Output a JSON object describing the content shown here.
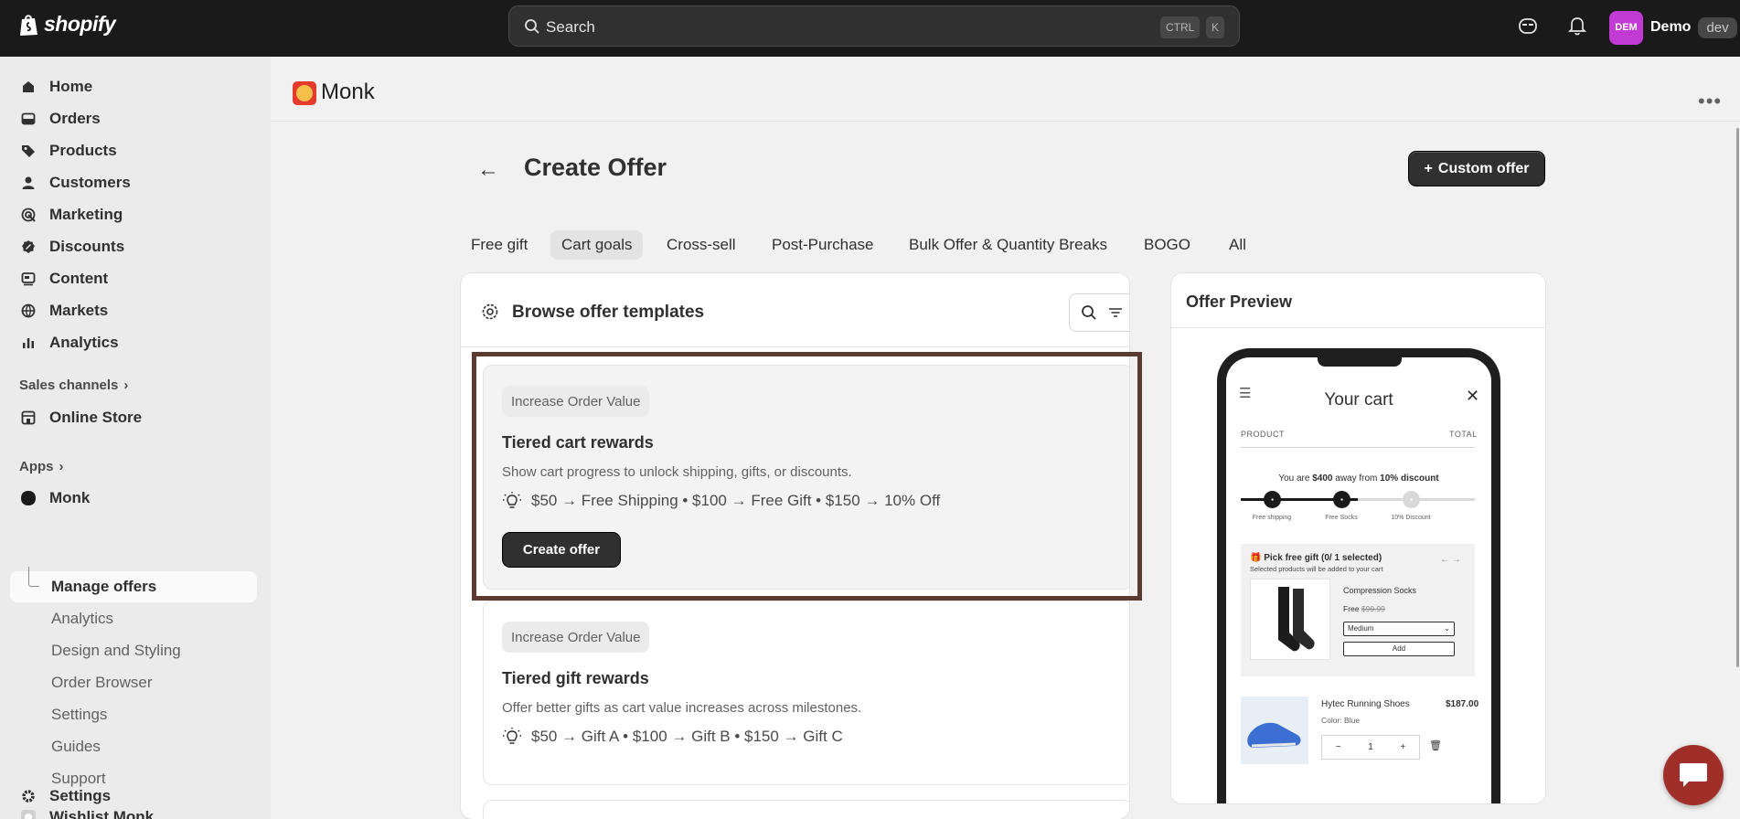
{
  "topbar": {
    "logo_text": "shopify",
    "search_placeholder": "Search",
    "shortcut_ctrl": "CTRL",
    "shortcut_key": "K",
    "account_initials": "DEM",
    "account_name": "Demo",
    "account_badge": "dev"
  },
  "sidebar": {
    "items": [
      {
        "label": "Home",
        "icon": "home-icon"
      },
      {
        "label": "Orders",
        "icon": "orders-icon"
      },
      {
        "label": "Products",
        "icon": "tag-icon"
      },
      {
        "label": "Customers",
        "icon": "person-icon"
      },
      {
        "label": "Marketing",
        "icon": "target-icon"
      },
      {
        "label": "Discounts",
        "icon": "discount-icon"
      },
      {
        "label": "Content",
        "icon": "content-icon"
      },
      {
        "label": "Markets",
        "icon": "globe-icon"
      },
      {
        "label": "Analytics",
        "icon": "bar-chart-icon"
      }
    ],
    "sales_channels_label": "Sales channels",
    "online_store_label": "Online Store",
    "apps_label": "Apps",
    "monk_label": "Monk",
    "monk_subitems": [
      "Manage offers",
      "Analytics",
      "Design and Styling",
      "Order Browser",
      "Settings",
      "Guides",
      "Support"
    ],
    "wishlist_label": "Wishlist Monk",
    "settings_label": "Settings"
  },
  "app": {
    "title": "Monk"
  },
  "page": {
    "title": "Create Offer",
    "custom_offer_label": "Custom offer",
    "tabs": [
      "Free gift",
      "Cart goals",
      "Cross-sell",
      "Post-Purchase",
      "Bulk Offer & Quantity Breaks",
      "BOGO",
      "All"
    ],
    "active_tab": "Cart goals"
  },
  "templates": {
    "title": "Browse offer templates",
    "offers": [
      {
        "badge": "Increase Order Value",
        "title": "Tiered cart rewards",
        "description": "Show cart progress to unlock shipping, gifts, or discounts.",
        "tiers": "$50 → Free Shipping • $100 → Free Gift • $150 → 10% Off",
        "button": "Create offer"
      },
      {
        "badge": "Increase Order Value",
        "title": "Tiered gift rewards",
        "description": "Offer better gifts as cart value increases across milestones.",
        "tiers": "$50 → Gift A • $100 → Gift B • $150 → Gift C"
      }
    ]
  },
  "preview": {
    "title": "Offer Preview",
    "cart_title": "Your cart",
    "col_product": "PRODUCT",
    "col_total": "TOTAL",
    "away_prefix": "You are",
    "away_amount": "$400",
    "away_mid": "away from",
    "away_goal": "10% discount",
    "milestones": [
      "Free shipping",
      "Free Socks",
      "10% Discount"
    ],
    "gift_title": "🎁 Pick free gift (0/ 1 selected)",
    "gift_sub": "Selected products will be added to your cart",
    "gift_name": "Compression Socks",
    "gift_free": "Free",
    "gift_old_price": "$99.99",
    "gift_variant": "Medium",
    "gift_add": "Add",
    "item_name": "Hytec Running Shoes",
    "item_price": "$187.00",
    "item_color": "Color: Blue",
    "item_qty": "1"
  }
}
